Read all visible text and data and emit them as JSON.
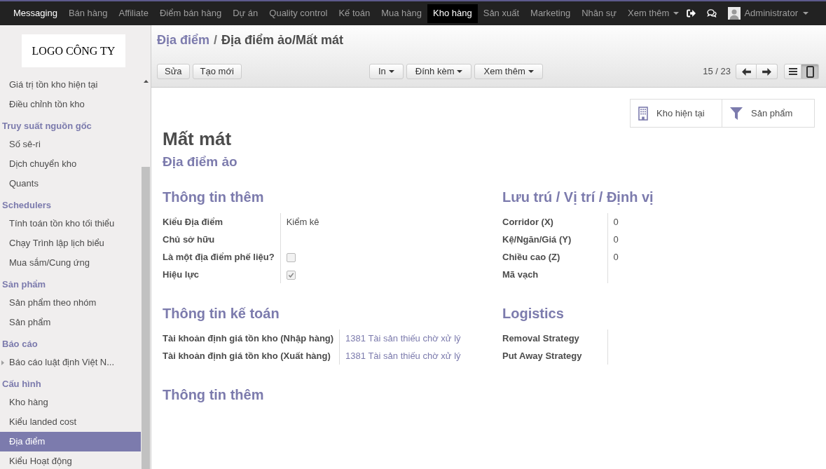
{
  "navbar": {
    "app": "Messaging",
    "menus": [
      {
        "label": "Bán hàng",
        "selected": false
      },
      {
        "label": "Affiliate",
        "selected": false
      },
      {
        "label": "Điểm bán hàng",
        "selected": false
      },
      {
        "label": "Dự án",
        "selected": false
      },
      {
        "label": "Quality control",
        "selected": false
      },
      {
        "label": "Kế toán",
        "selected": false
      },
      {
        "label": "Mua hàng",
        "selected": false
      },
      {
        "label": "Kho hàng",
        "selected": true
      },
      {
        "label": "Sản xuất",
        "selected": false
      },
      {
        "label": "Marketing",
        "selected": false
      },
      {
        "label": "Nhân sự",
        "selected": false
      }
    ],
    "more": "Xem thêm",
    "user": "Administrator"
  },
  "sidebar": {
    "logo": "LOGO CÔNG TY",
    "sections": [
      {
        "items": [
          {
            "label": "Giá trị tồn kho hiện tại",
            "kind": "action",
            "selected": false
          },
          {
            "label": "Điều chỉnh tồn kho",
            "kind": "action",
            "selected": false
          }
        ]
      },
      {
        "title": "Truy suất nguồn gốc",
        "items": [
          {
            "label": "Số sê-ri",
            "kind": "action",
            "selected": false
          },
          {
            "label": "Dịch chuyển kho",
            "kind": "action",
            "selected": false
          },
          {
            "label": "Quants",
            "kind": "action",
            "selected": false
          }
        ]
      },
      {
        "title": "Schedulers",
        "items": [
          {
            "label": "Tính toán tồn kho tối thiểu",
            "kind": "action",
            "selected": false
          },
          {
            "label": "Chạy Trình lập lịch biểu",
            "kind": "action",
            "selected": false
          },
          {
            "label": "Mua sắm/Cung ứng",
            "kind": "action",
            "selected": false
          }
        ]
      },
      {
        "title": "Sản phẩm",
        "items": [
          {
            "label": "Sản phẩm theo nhóm",
            "kind": "action",
            "selected": false
          },
          {
            "label": "Sản phẩm",
            "kind": "action",
            "selected": false
          }
        ]
      },
      {
        "title": "Báo cáo",
        "items": [
          {
            "label": "Báo cáo luật định Việt N...",
            "kind": "submenu",
            "selected": false
          }
        ]
      },
      {
        "title": "Cấu hình",
        "items": [
          {
            "label": "Kho hàng",
            "kind": "action",
            "selected": false
          },
          {
            "label": "Kiểu landed cost",
            "kind": "action",
            "selected": false
          },
          {
            "label": "Địa điểm",
            "kind": "action",
            "selected": true
          },
          {
            "label": "Kiểu Hoạt động",
            "kind": "action",
            "selected": false
          }
        ]
      }
    ]
  },
  "control_panel": {
    "breadcrumb": {
      "parent": "Địa điểm",
      "separator": "/",
      "current": "Địa điểm ảo/Mất mát"
    },
    "buttons": [
      "Sửa",
      "Tạo mới"
    ],
    "dropdowns": [
      "In",
      "Đính kèm",
      "Xem thêm"
    ],
    "pager": "15 / 23",
    "views": [
      {
        "kind": "list",
        "selected": false
      },
      {
        "kind": "form",
        "selected": true
      }
    ]
  },
  "sheet": {
    "stat_buttons": [
      "Kho hiện tại",
      "Sản phẩm"
    ],
    "title": "Mất mát",
    "subtitle": "Địa điểm ảo",
    "rows": [
      [
        {
          "title": "Thông tin thêm",
          "fields": [
            {
              "label": "Kiểu Địa điểm",
              "kind": "text",
              "value": "Kiểm kê"
            },
            {
              "label": "Chủ sở hữu",
              "kind": "text"
            },
            {
              "label": "Là một địa điểm phế liệu?",
              "kind": "checkbox",
              "checked": false
            },
            {
              "label": "Hiệu lực",
              "kind": "checkbox",
              "checked": true
            }
          ]
        },
        {
          "title": "Lưu trú / Vị trí / Định vị",
          "fields": [
            {
              "label": "Corridor (X)",
              "kind": "text",
              "value": "0"
            },
            {
              "label": "Kệ/Ngăn/Giá (Y)",
              "kind": "text",
              "value": "0"
            },
            {
              "label": "Chiều cao (Z)",
              "kind": "text",
              "value": "0"
            },
            {
              "label": "Mã vạch",
              "kind": "text"
            }
          ]
        }
      ],
      [
        {
          "title": "Thông tin kế toán",
          "fields": [
            {
              "label": "Tài khoản định giá tồn kho (Nhập hàng)",
              "kind": "link",
              "value": "1381 Tài sản thiếu chờ xử lý"
            },
            {
              "label": "Tài khoản định giá tồn kho (Xuất hàng)",
              "kind": "link",
              "value": "1381 Tài sản thiếu chờ xử lý"
            }
          ]
        },
        {
          "title": "Logistics",
          "fields": [
            {
              "label": "Removal Strategy",
              "kind": "text"
            },
            {
              "label": "Put Away Strategy",
              "kind": "text"
            }
          ]
        }
      ],
      [
        {
          "title": "Thông tin thêm"
        }
      ]
    ]
  }
}
